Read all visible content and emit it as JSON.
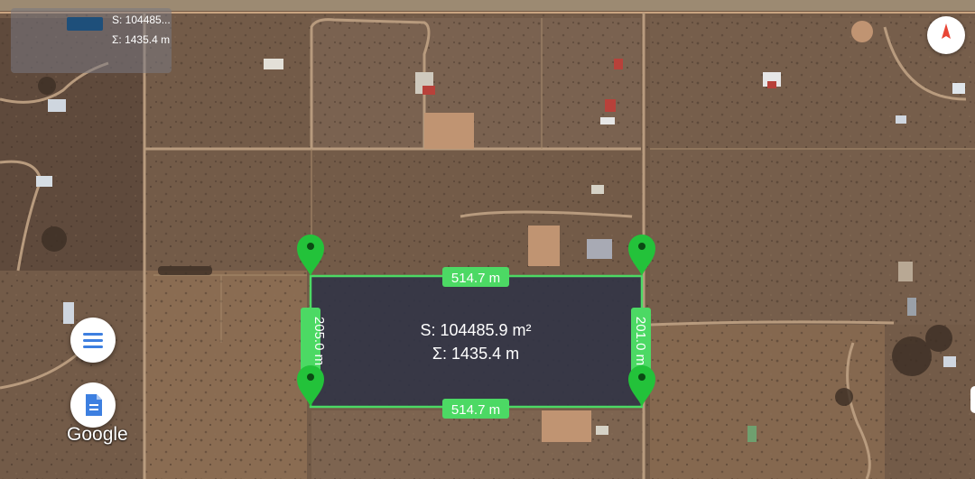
{
  "measure_info": {
    "area_label": "S: 104485...",
    "perimeter_label": "Σ: 1435.4 m",
    "swatch_color": "#1e4f7a"
  },
  "polygon": {
    "area_label": "S: 104485.9 m²",
    "perimeter_label": "Σ: 1435.4 m",
    "fill_color": "#2e3246",
    "stroke_color": "#4cd964",
    "edge_labels": {
      "top": "514.7 m",
      "bottom": "514.7 m",
      "left": "205.0 m",
      "right": "201.0 m"
    }
  },
  "logo": "Google",
  "icons": {
    "compass": "compass-icon",
    "menu": "menu-icon",
    "document": "document-icon",
    "pin": "map-pin-icon"
  },
  "colors": {
    "pin": "#23c23a",
    "fab_icon": "#3d7fe0",
    "compass_needle": "#e84535"
  }
}
